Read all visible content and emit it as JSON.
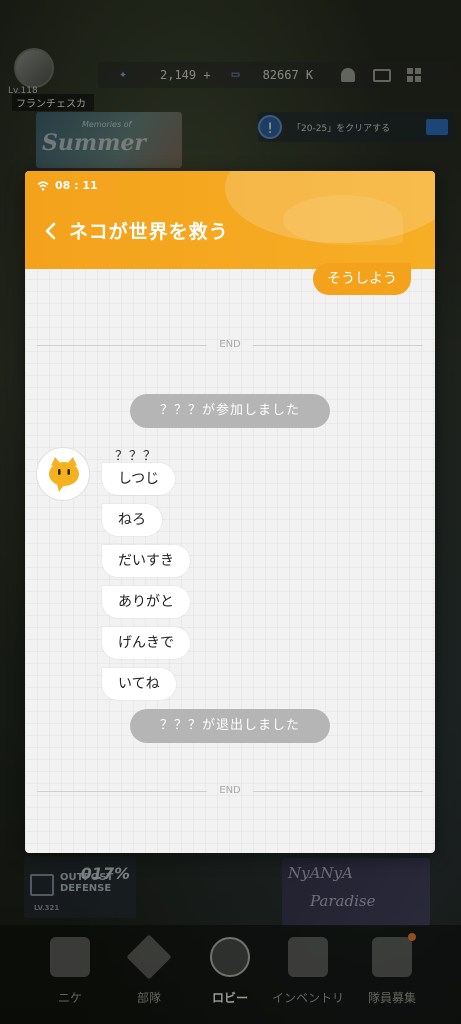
{
  "background": {
    "player": {
      "level": "Lv.118",
      "name": "フランチェスカ"
    },
    "currency": {
      "gems": "2,149 +",
      "credits": "82667 K"
    },
    "mission_text": "「20-25」をクリアする",
    "banner": {
      "title": "Summer",
      "subtitle": "Memories of"
    },
    "outpost": {
      "title_line1": "OUTPOST",
      "title_line2": "DEFENSE",
      "percent": "017%",
      "level": "LV.321"
    },
    "event_banner": {
      "line1": "NyANyA",
      "line2": "Paradise"
    },
    "nav": [
      {
        "label": "ニケ",
        "icon": "nikke-icon"
      },
      {
        "label": "部隊",
        "icon": "squad-icon"
      },
      {
        "label": "ロビー",
        "icon": "lobby-icon"
      },
      {
        "label": "インベントリ",
        "icon": "inventory-icon"
      },
      {
        "label": "隊員募集",
        "icon": "recruit-icon"
      }
    ]
  },
  "chat": {
    "status_time": "08 : 11",
    "title": "ネコが世界を救う",
    "accent_color": "#f4a21c",
    "outgoing_message": "そうしよう",
    "end_label": "END",
    "join_notice": "？？？が参加しました",
    "sender_name": "？？？",
    "messages": [
      "しつじ",
      "ねろ",
      "だいすき",
      "ありがと",
      "げんきで",
      "いてね"
    ],
    "leave_notice": "？？？が退出しました"
  }
}
